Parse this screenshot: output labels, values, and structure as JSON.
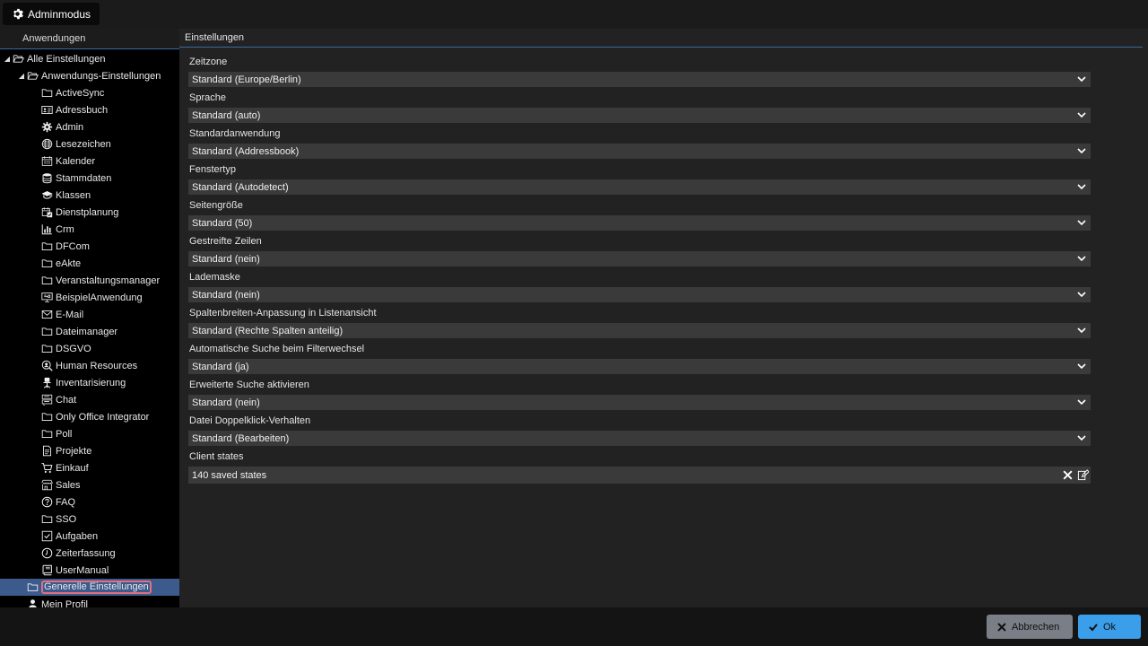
{
  "topbar": {
    "admin_label": "Adminmodus"
  },
  "left": {
    "header": "Anwendungen",
    "tree": [
      {
        "label": "Alle Einstellungen",
        "icon": "folder-open-icon",
        "level": 0,
        "twisty": "open"
      },
      {
        "label": "Anwendungs-Einstellungen",
        "icon": "folder-open-icon",
        "level": 1,
        "twisty": "open"
      },
      {
        "label": "ActiveSync",
        "icon": "folder-icon",
        "level": 2
      },
      {
        "label": "Adressbuch",
        "icon": "address-card-icon",
        "level": 2
      },
      {
        "label": "Admin",
        "icon": "gear-icon",
        "level": 2
      },
      {
        "label": "Lesezeichen",
        "icon": "globe-icon",
        "level": 2
      },
      {
        "label": "Kalender",
        "icon": "calendar-icon",
        "level": 2
      },
      {
        "label": "Stammdaten",
        "icon": "database-icon",
        "level": 2
      },
      {
        "label": "Klassen",
        "icon": "graduation-cap-icon",
        "level": 2
      },
      {
        "label": "Dienstplanung",
        "icon": "calendar-check-icon",
        "level": 2
      },
      {
        "label": "Crm",
        "icon": "bar-chart-icon",
        "level": 2
      },
      {
        "label": "DFCom",
        "icon": "folder-icon",
        "level": 2
      },
      {
        "label": "eAkte",
        "icon": "folder-icon",
        "level": 2
      },
      {
        "label": "Veranstaltungsmanager",
        "icon": "folder-icon",
        "level": 2
      },
      {
        "label": "BeispielAnwendung",
        "icon": "monitor-icon",
        "level": 2
      },
      {
        "label": "E-Mail",
        "icon": "envelope-icon",
        "level": 2
      },
      {
        "label": "Dateimanager",
        "icon": "folder-icon",
        "level": 2
      },
      {
        "label": "DSGVO",
        "icon": "folder-icon",
        "level": 2
      },
      {
        "label": "Human Resources",
        "icon": "user-search-icon",
        "level": 2
      },
      {
        "label": "Inventarisierung",
        "icon": "chair-icon",
        "level": 2
      },
      {
        "label": "Chat",
        "icon": "chat-icon",
        "level": 2
      },
      {
        "label": "Only Office Integrator",
        "icon": "folder-icon",
        "level": 2
      },
      {
        "label": "Poll",
        "icon": "folder-icon",
        "level": 2
      },
      {
        "label": "Projekte",
        "icon": "document-icon",
        "level": 2
      },
      {
        "label": "Einkauf",
        "icon": "cart-icon",
        "level": 2
      },
      {
        "label": "Sales",
        "icon": "store-icon",
        "level": 2
      },
      {
        "label": "FAQ",
        "icon": "question-circle-icon",
        "level": 2
      },
      {
        "label": "SSO",
        "icon": "folder-icon",
        "level": 2
      },
      {
        "label": "Aufgaben",
        "icon": "checkbox-icon",
        "level": 2
      },
      {
        "label": "Zeiterfassung",
        "icon": "clock-icon",
        "level": 2
      },
      {
        "label": "UserManual",
        "icon": "book-icon",
        "level": 2
      },
      {
        "label": "Generelle Einstellungen",
        "icon": "folder-icon",
        "level": 1,
        "selected": true
      },
      {
        "label": "Mein Profil",
        "icon": "user-icon",
        "level": 1
      }
    ]
  },
  "main": {
    "header": "Einstellungen",
    "fields": [
      {
        "label": "Zeitzone",
        "value": "Standard (Europe/Berlin)"
      },
      {
        "label": "Sprache",
        "value": "Standard (auto)"
      },
      {
        "label": "Standardanwendung",
        "value": "Standard (Addressbook)"
      },
      {
        "label": "Fenstertyp",
        "value": "Standard (Autodetect)"
      },
      {
        "label": "Seitengröße",
        "value": "Standard (50)"
      },
      {
        "label": "Gestreifte Zeilen",
        "value": "Standard (nein)"
      },
      {
        "label": "Lademaske",
        "value": "Standard (nein)"
      },
      {
        "label": "Spaltenbreiten-Anpassung in Listenansicht",
        "value": "Standard (Rechte Spalten anteilig)"
      },
      {
        "label": "Automatische Suche beim Filterwechsel",
        "value": "Standard (ja)"
      },
      {
        "label": "Erweiterte Suche aktivieren",
        "value": "Standard (nein)"
      },
      {
        "label": "Datei Doppelklick-Verhalten",
        "value": "Standard (Bearbeiten)"
      }
    ],
    "client_states": {
      "label": "Client states",
      "value": "140 saved states"
    }
  },
  "footer": {
    "cancel_label": "Abbrechen",
    "ok_label": "Ok"
  }
}
